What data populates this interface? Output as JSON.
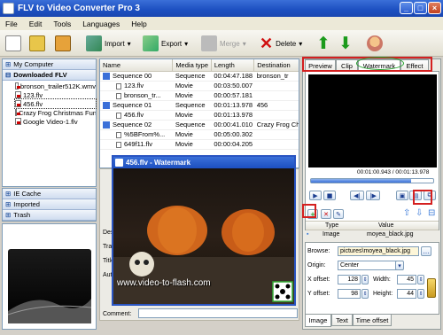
{
  "window": {
    "title": "FLV to Video Converter Pro 3"
  },
  "menu": [
    "File",
    "Edit",
    "Tools",
    "Languages",
    "Help"
  ],
  "toolbar": {
    "import": "Import",
    "export": "Export",
    "merge": "Merge",
    "delete": "Delete"
  },
  "sidebar": {
    "my_computer": "My Computer",
    "downloaded": "Downloaded FLV",
    "files": [
      "bronson_trailer512K.wmv",
      "123.flv",
      "456.flv",
      "Crazy Frog Christmas Fun",
      "Google Video-1.flv"
    ],
    "ie_cache": "IE Cache",
    "imported": "Imported",
    "trash": "Trash"
  },
  "table": {
    "headers": [
      "Name",
      "Media type",
      "Length",
      "Destination"
    ],
    "rows": [
      {
        "name": "Sequence 00",
        "type": "Sequence",
        "length": "00:04:47.188",
        "dest": "bronson_tr"
      },
      {
        "name": "123.flv",
        "type": "Movie",
        "length": "00:03:50.007",
        "dest": ""
      },
      {
        "name": "bronson_tr...",
        "type": "Movie",
        "length": "00:00:57.181",
        "dest": ""
      },
      {
        "name": "Sequence 01",
        "type": "Sequence",
        "length": "00:01:13.978",
        "dest": "456"
      },
      {
        "name": "456.flv",
        "type": "Movie",
        "length": "00:01:13.978",
        "dest": ""
      },
      {
        "name": "Sequence 02",
        "type": "Sequence",
        "length": "00:00:41.010",
        "dest": "Crazy Frog Ch"
      },
      {
        "name": "%5BFrom%...",
        "type": "Movie",
        "length": "00:05:00.302",
        "dest": ""
      },
      {
        "name": "649f11.flv",
        "type": "Movie",
        "length": "00:00:04.205",
        "dest": ""
      }
    ]
  },
  "details": {
    "labels": [
      "Des",
      "Tra",
      "Title",
      "Aut"
    ],
    "comment": "Comment:"
  },
  "watermark_window": {
    "title": "456.flv - Watermark",
    "overlay_text": "www.video-to-flash.com"
  },
  "right": {
    "tabs": [
      "Preview",
      "Clip",
      "Watermark",
      "Effect"
    ],
    "time": "00:01:00.943 / 00:01:13.978",
    "list_headers": [
      "Type",
      "Value"
    ],
    "list_row": {
      "type": "Image",
      "value": "moyea_black.jpg"
    },
    "browse_label": "Browse:",
    "browse_value": "pictures\\moyea_black.jpg",
    "origin_label": "Origin:",
    "origin_value": "Center",
    "xoffset_label": "X offset:",
    "xoffset": "128",
    "yoffset_label": "Y offset:",
    "yoffset": "98",
    "width_label": "Width:",
    "width": "45",
    "height_label": "Height:",
    "height": "44",
    "bottom_tabs": [
      "Image",
      "Text",
      "Time offset"
    ],
    "playhead_fraction": 0.82
  }
}
